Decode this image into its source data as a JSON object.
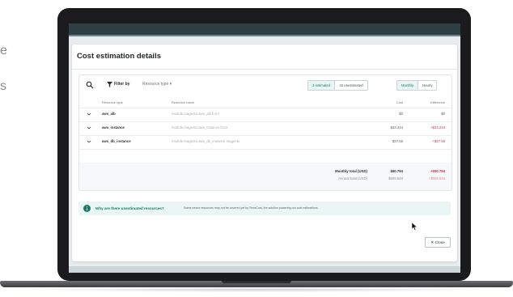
{
  "background_text": {
    "line1": "e",
    "line2": "s"
  },
  "modal": {
    "title": "Cost estimation details",
    "toolbar": {
      "filter_label": "Filter by",
      "type_select": "Resource type ▾",
      "estimated": "3 estimated",
      "unestimated": "15 unestimated",
      "monthly": "Monthly",
      "hourly": "Hourly"
    },
    "columns": {
      "type": "Resource type",
      "name": "Resource name",
      "cost": "Cost",
      "difference": "Difference"
    },
    "rows": [
      {
        "type": "aws_alb",
        "name": "module.magento.aws_alb.front",
        "cost": "$0",
        "difference": "$0"
      },
      {
        "type": "aws_instance",
        "name": "module.magento.aws_instance.front",
        "cost": "$23.244",
        "difference": "+$23.244"
      },
      {
        "type": "aws_db_instance",
        "name": "module.magento.aws_db_instance.magento",
        "cost": "$27.55",
        "difference": "+$27.55"
      }
    ],
    "totals": {
      "monthly_label": "Monthly total (USD)",
      "monthly_cost": "$50.794",
      "monthly_diff": "+$50.794",
      "annual_label": "Annual total (USD)",
      "annual_cost": "$609.528",
      "annual_diff": "+$609.528"
    },
    "info": {
      "question": "Why are there unestimated resources?",
      "text": "Some newer resources may not be covered yet by TerraCost, the solution powering our cost estimations."
    },
    "close_label": "✕ Close"
  },
  "colors": {
    "accent": "#1d7a6b",
    "negative": "#c0334f",
    "app_bar": "#2e3e45"
  }
}
